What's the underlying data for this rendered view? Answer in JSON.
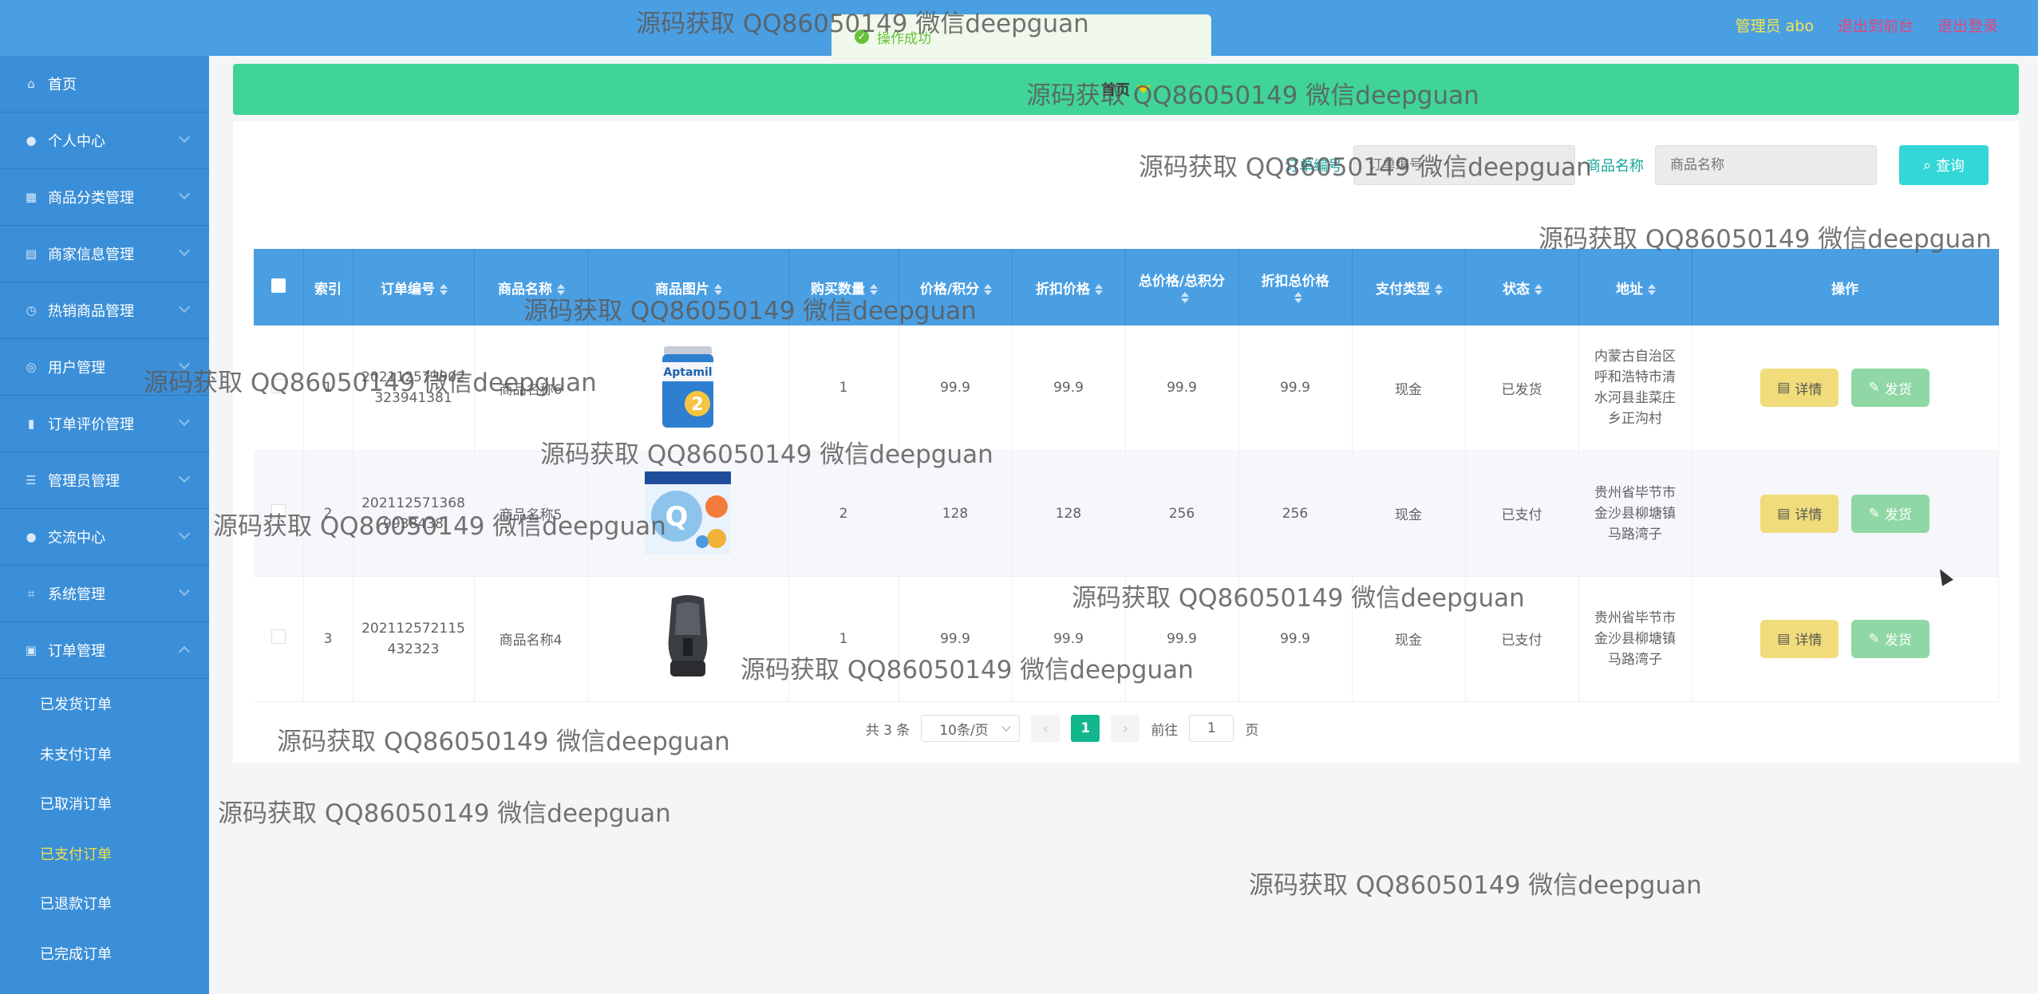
{
  "header": {
    "admin_label": "管理员 abo",
    "back_link": "退出到前台",
    "logout_link": "退出登录"
  },
  "toast": {
    "message": "操作成功"
  },
  "sidebar": {
    "items": [
      {
        "label": "首页",
        "icon": "home-icon"
      },
      {
        "label": "个人中心",
        "icon": "user-icon"
      },
      {
        "label": "商品分类管理",
        "icon": "grid-icon"
      },
      {
        "label": "商家信息管理",
        "icon": "clipboard-icon"
      },
      {
        "label": "热销商品管理",
        "icon": "clock-icon"
      },
      {
        "label": "用户管理",
        "icon": "compass-icon"
      },
      {
        "label": "订单评价管理",
        "icon": "chart-icon"
      },
      {
        "label": "管理员管理",
        "icon": "list-icon"
      },
      {
        "label": "交流中心",
        "icon": "user-icon"
      },
      {
        "label": "系统管理",
        "icon": "crop-icon"
      },
      {
        "label": "订单管理",
        "icon": "document-icon"
      }
    ],
    "sub_items": [
      "已发货订单",
      "未支付订单",
      "已取消订单",
      "已支付订单",
      "已退款订单",
      "已完成订单"
    ]
  },
  "breadcrumb": {
    "home": "首页"
  },
  "search": {
    "order_label": "订单编号",
    "order_placeholder": "订单编号",
    "name_label": "商品名称",
    "name_placeholder": "商品名称",
    "button": "查询"
  },
  "table": {
    "headers": [
      "索引",
      "订单编号",
      "商品名称",
      "商品图片",
      "购买数量",
      "价格/积分",
      "折扣价格",
      "总价格/总积分",
      "折扣总价格",
      "支付类型",
      "状态",
      "地址",
      "操作"
    ],
    "rows": [
      {
        "index": "1",
        "order_no": "202112573902323941381",
        "name": "商品名称6",
        "image": "milk-formula-can",
        "qty": "1",
        "price": "99.9",
        "discount": "99.9",
        "total": "99.9",
        "discount_total": "99.9",
        "pay": "现金",
        "status": "已发货",
        "address": "内蒙古自治区呼和浩特市清水河县韭菜庄乡正沟村"
      },
      {
        "index": "2",
        "order_no": "2021125713689938438",
        "name": "商品名称5",
        "image": "milk-powder-box",
        "qty": "2",
        "price": "128",
        "discount": "128",
        "total": "256",
        "discount_total": "256",
        "pay": "现金",
        "status": "已支付",
        "address": "贵州省毕节市金沙县柳塘镇马路湾子"
      },
      {
        "index": "3",
        "order_no": "202112572115432323",
        "name": "商品名称4",
        "image": "car-seat",
        "qty": "1",
        "price": "99.9",
        "discount": "99.9",
        "total": "99.9",
        "discount_total": "99.9",
        "pay": "现金",
        "status": "已支付",
        "address": "贵州省毕节市金沙县柳塘镇马路湾子"
      }
    ],
    "detail_button": "详情",
    "ship_button": "发货"
  },
  "pager": {
    "total": "共 3 条",
    "page_size": "10条/页",
    "current": "1",
    "goto_label": "前往",
    "goto_value": "1",
    "page_suffix": "页"
  },
  "watermark": "源码获取 QQ86050149 微信deepguan",
  "colors": {
    "topbar": "#4a9fe3",
    "sidebar": "#3b8fd8",
    "breadcrumb": "#41d498",
    "table_header": "#4a9fe3",
    "search_button": "#33d7d7",
    "detail_button": "#f0dc7a",
    "ship_button": "#8fd7a4",
    "active_submenu": "#f0e04b"
  }
}
